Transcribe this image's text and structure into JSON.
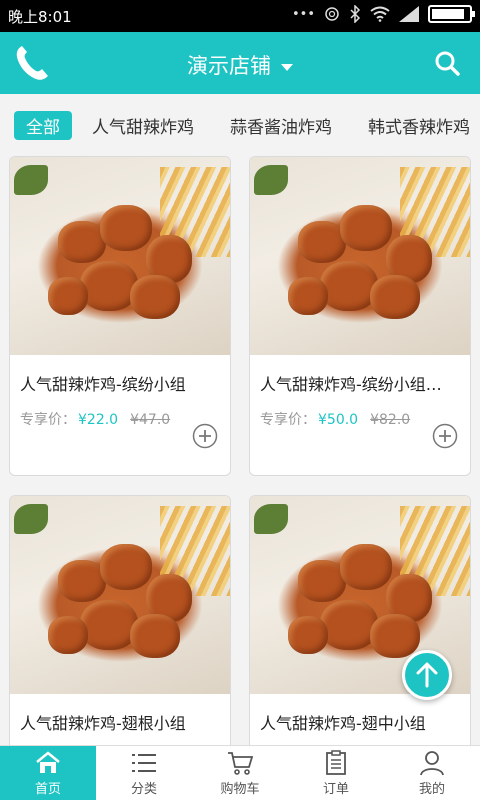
{
  "status_bar": {
    "time": "晚上8:01",
    "icons": [
      "more-icon",
      "alarm-icon",
      "bluetooth-icon",
      "wifi-icon",
      "signal-icon",
      "battery-icon"
    ],
    "battery_level": 0.9
  },
  "header": {
    "store_name": "演示店铺",
    "left_icon": "phone-icon",
    "right_icon": "search-icon"
  },
  "tabs": [
    {
      "label": "全部",
      "active": true
    },
    {
      "label": "人气甜辣炸鸡",
      "active": false
    },
    {
      "label": "蒜香酱油炸鸡",
      "active": false
    },
    {
      "label": "韩式香辣炸鸡",
      "active": false
    }
  ],
  "products": [
    {
      "name": "人气甜辣炸鸡-缤纷小组",
      "price_label": "专享价：",
      "price": "¥22.0",
      "original_price": "¥47.0"
    },
    {
      "name": "人气甜辣炸鸡-缤纷小组…",
      "price_label": "专享价：",
      "price": "¥50.0",
      "original_price": "¥82.0"
    },
    {
      "name": "人气甜辣炸鸡-翅根小组",
      "price_label": "",
      "price": "",
      "original_price": ""
    },
    {
      "name": "人气甜辣炸鸡-翅中小组",
      "price_label": "",
      "price": "",
      "original_price": ""
    }
  ],
  "bottom_nav": [
    {
      "label": "首页",
      "icon": "home-icon",
      "active": true
    },
    {
      "label": "分类",
      "icon": "list-icon",
      "active": false
    },
    {
      "label": "购物车",
      "icon": "cart-icon",
      "active": false
    },
    {
      "label": "订单",
      "icon": "order-icon",
      "active": false
    },
    {
      "label": "我的",
      "icon": "user-icon",
      "active": false
    }
  ],
  "colors": {
    "accent": "#1ec4c4",
    "price": "#1ec4c4",
    "status_bar": "#000000"
  }
}
